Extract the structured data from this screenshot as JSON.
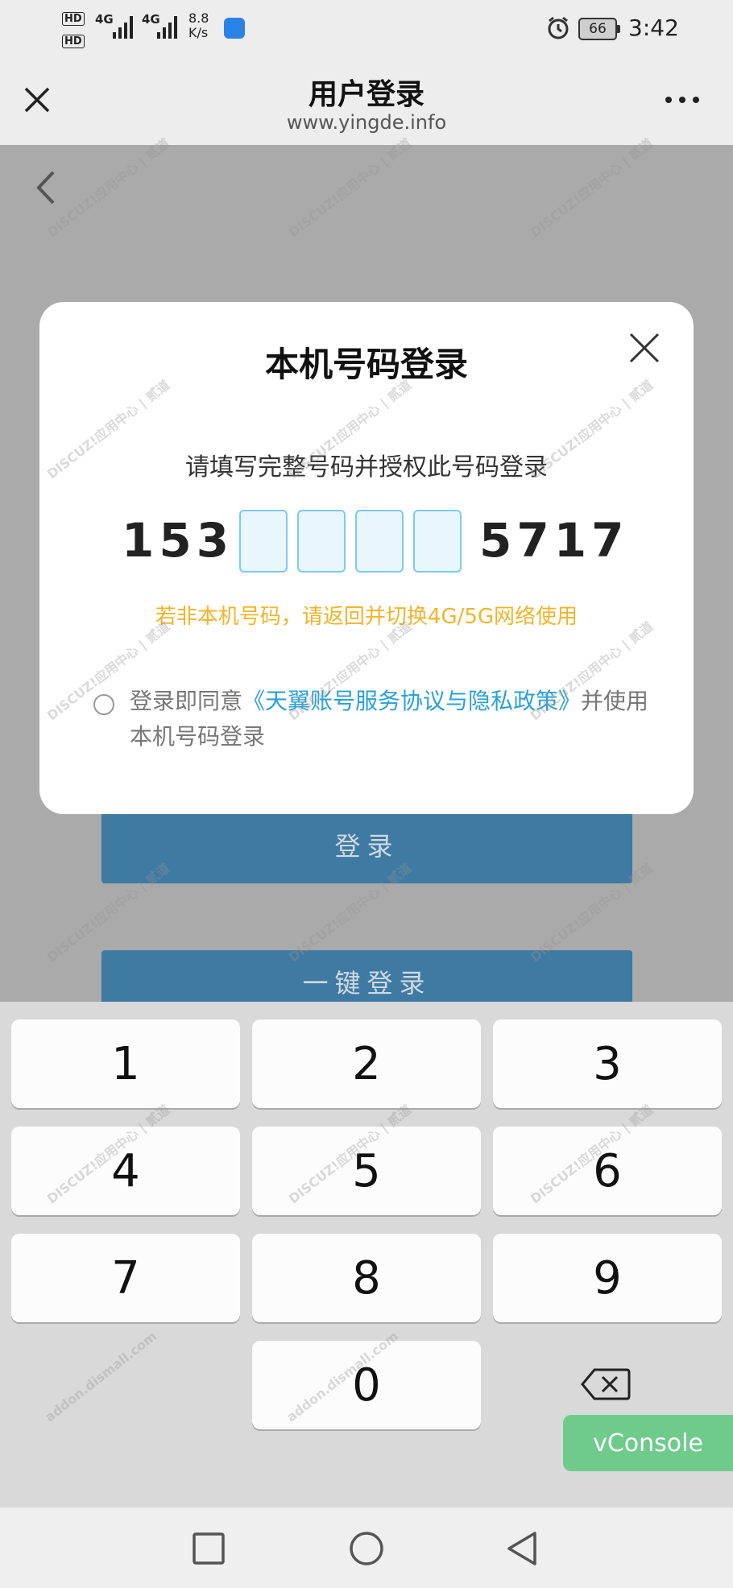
{
  "status_bar": {
    "hd1": "HD",
    "hd2": "HD",
    "net1": "4G",
    "net2": "4G",
    "speed_value": "8.8",
    "speed_unit": "K/s",
    "battery": "66",
    "time": "3:42"
  },
  "title_bar": {
    "title": "用户登录",
    "url": "www.yingde.info"
  },
  "background_page": {
    "login_button": "登录",
    "one_tap_button": "一键登录"
  },
  "modal": {
    "title": "本机号码登录",
    "instruction": "请填写完整号码并授权此号码登录",
    "phone_prefix": "153",
    "phone_suffix": "5717",
    "masked_digit_count": 4,
    "warning": "若非本机号码，请返回并切换4G/5G网络使用",
    "agree_prefix": "登录即同意",
    "agree_link": "《天翼账号服务协议与隐私政策》",
    "agree_suffix": "并使用本机号码登录"
  },
  "keypad": {
    "keys": [
      "1",
      "2",
      "3",
      "4",
      "5",
      "6",
      "7",
      "8",
      "9",
      "0"
    ]
  },
  "vconsole": {
    "label": "vConsole"
  },
  "watermark": {
    "text": "DISCUZ!应用中心 | 贰道",
    "subtext": "addon.dismall.com"
  },
  "colors": {
    "accent_blue": "#2aa1d8",
    "warning_yellow": "#f2b42a",
    "vconsole_green": "#6fcb8b",
    "bg_button_blue": "#3f7aa2"
  }
}
